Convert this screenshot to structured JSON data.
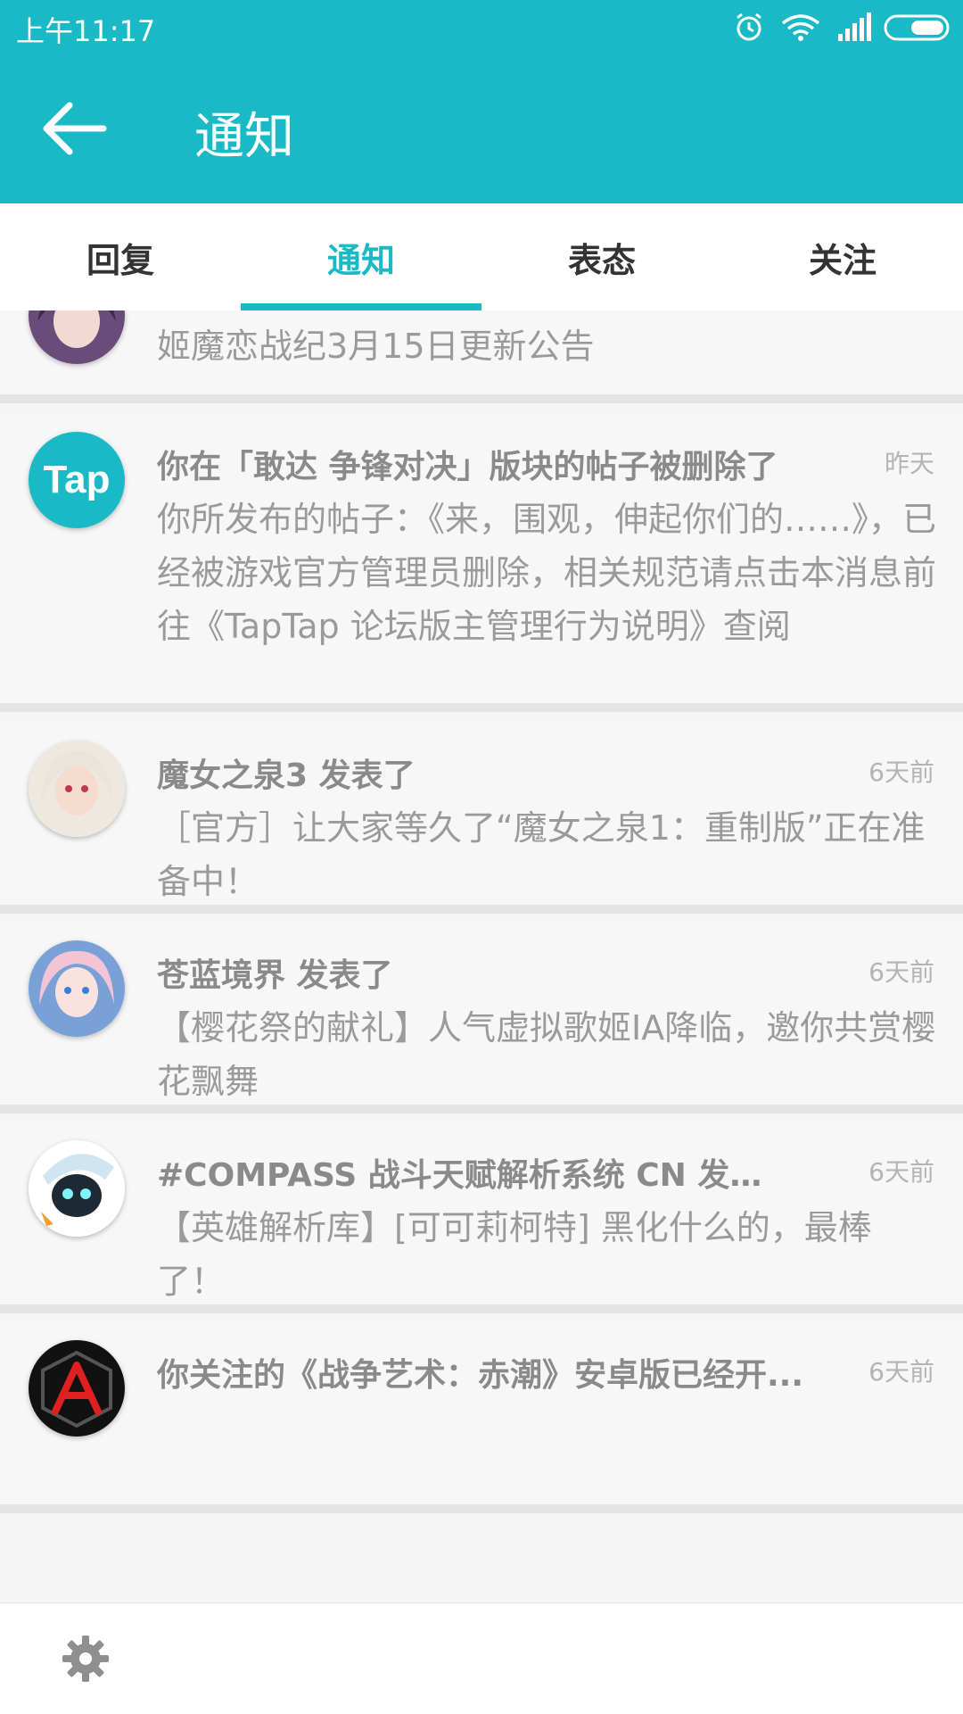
{
  "status_bar": {
    "time": "上午11:17"
  },
  "app_bar": {
    "title": "通知"
  },
  "tabs": [
    {
      "label": "回复",
      "active": false
    },
    {
      "label": "通知",
      "active": true
    },
    {
      "label": "表态",
      "active": false
    },
    {
      "label": "关注",
      "active": false
    }
  ],
  "notifications": [
    {
      "title": "",
      "time": "",
      "body": "姬魔恋战纪3月15日更新公告",
      "avatar_icon": "anime-character-avatar-icon"
    },
    {
      "title": "你在「敢达 争锋对决」版块的帖子被删除了",
      "time": "昨天",
      "body": "你所发布的帖子：《来，围观，伸起你们的……》，已经被游戏官方管理员删除，相关规范请点击本消息前往《TapTap 论坛版主管理行为说明》查阅",
      "avatar_icon": "taptap-logo-icon",
      "avatar_text": "Tap"
    },
    {
      "title": "魔女之泉3 发表了",
      "time": "6天前",
      "body": "［官方］让大家等久了“魔女之泉1：重制版”正在准备中！",
      "avatar_icon": "anime-character-avatar-icon"
    },
    {
      "title": "苍蓝境界 发表了",
      "time": "6天前",
      "body": "【樱花祭的献礼】人气虚拟歌姬IA降临，邀你共赏樱花飘舞",
      "avatar_icon": "anime-character-avatar-icon"
    },
    {
      "title": "#COMPASS 战斗天赋解析系统 CN 发表了",
      "time": "6天前",
      "body": "【英雄解析库】[可可莉柯特] 黑化什么的，最棒了！",
      "avatar_icon": "robot-character-avatar-icon"
    },
    {
      "title": "你关注的《战争艺术：赤潮》安卓版已经开...",
      "time": "6天前",
      "body": "",
      "avatar_icon": "red-tide-logo-icon"
    }
  ],
  "bottom_bar": {
    "settings_icon": "gear-icon"
  },
  "colors": {
    "accent": "#19b9c6",
    "card_bg": "#f7f7f7",
    "divider": "#e4e4e4"
  }
}
